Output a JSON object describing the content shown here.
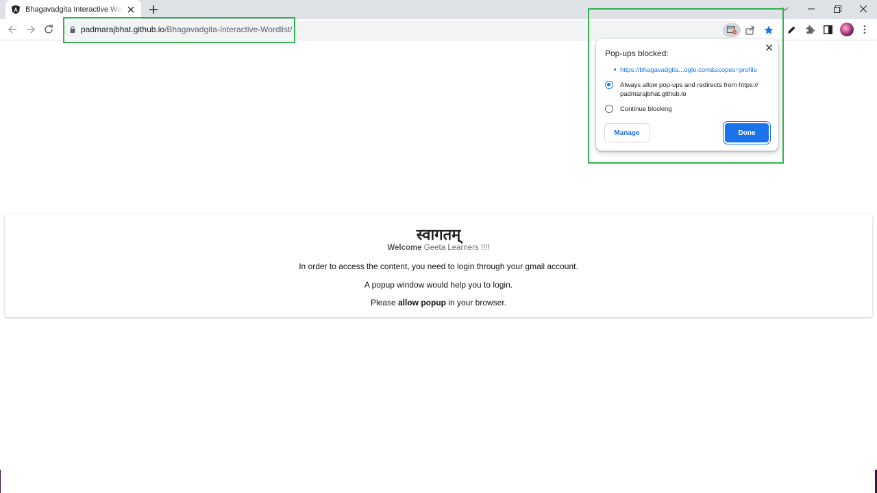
{
  "browser": {
    "tab": {
      "title": "Bhagavadgita Interactive Wordlist",
      "favicon": "angular-icon"
    },
    "address": {
      "domain": "padmarajbhat.github.io",
      "path": "/Bhagavadgita-Interactive-Wordlist/"
    }
  },
  "popup_bubble": {
    "title": "Pop-ups blocked:",
    "blocked_link": "https://bhagavadgita...ogle.com&scopes=profile",
    "option_allow_line1": "Always allow pop-ups and redirects from https://",
    "option_allow_line2": "padmarajbhat.github.io",
    "option_block": "Continue blocking",
    "selected_option": "allow",
    "manage_label": "Manage",
    "done_label": "Done"
  },
  "page": {
    "heading": "स्वागतम्",
    "welcome_bold": "Welcome",
    "welcome_rest": " Geeta Learners !!!!",
    "line1": "In order to access the content, you need to login through your gmail account.",
    "line2": "A popup window would help you to login.",
    "line3_before": "Please ",
    "line3_bold": "allow popup",
    "line3_after": " in your browser."
  },
  "colors": {
    "accent": "#1a73e8",
    "highlight": "#2fb24f",
    "tabstrip": "#dee1e6"
  }
}
